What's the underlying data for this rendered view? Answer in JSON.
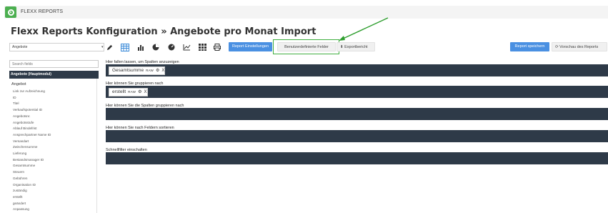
{
  "app": {
    "brand": "FLEXX REPORTS"
  },
  "page": {
    "title": "Flexx Reports Konfiguration » Angebote pro Monat Import"
  },
  "toolbar": {
    "module_select": "Angebote",
    "report_settings_label": "Report Einstellungen",
    "custom_fields_label": "Benutzerdefinierte Felder",
    "export_label": "Exportbericht",
    "save_label": "Report speichern",
    "preview_label": "Vorschau des Reports"
  },
  "sidebar": {
    "search_placeholder": "Search fields",
    "module_head": "Angebote (Hauptmodul)",
    "group_label": "Angebot",
    "fields": [
      "Link zur Aufzeichnung",
      "ID",
      "Titel",
      "Verkaufspotential ID",
      "Angebotsnr.",
      "Angebotsstufe",
      "Ablauf Bindefrist",
      "Ansprechpartner Name ID",
      "Versandart",
      "Zwischensumme",
      "Lieferung",
      "Bestandsmanager ID",
      "Gesamtsumme",
      "Steuern",
      "Gebühren",
      "Organisation ID",
      "zuständig",
      "erstellt",
      "geändert",
      "Anpassung"
    ]
  },
  "zones": {
    "columns_label": "Hier fallen lassen, um Spalten anzuzeigen",
    "group_label": "Hier können Sie gruppieren nach",
    "group_columns_label": "Hier können Sie die Spalten gruppieren nach",
    "sort_label": "Hier können Sie nach Feldern sortieren",
    "quickfilter_label": "Schnellfilter einschalten"
  },
  "chips": {
    "column_chip": {
      "name": "Gesamtsumme",
      "tag": "RAW",
      "remove": "X"
    },
    "group_chip": {
      "name": "erstellt",
      "tag": "RAW",
      "remove": "X"
    }
  },
  "colors": {
    "accent_blue": "#4a90e2",
    "brand_green": "#4caf50",
    "zone_dark": "#2e3a48",
    "highlight_green": "#3fae3f"
  },
  "icons": [
    "logo-icon",
    "pencil-icon",
    "table-icon",
    "bar-chart-icon",
    "pie-chart-icon",
    "gauge-icon",
    "line-chart-icon",
    "grid-icon",
    "print-icon",
    "download-icon",
    "refresh-icon",
    "gear-icon"
  ]
}
